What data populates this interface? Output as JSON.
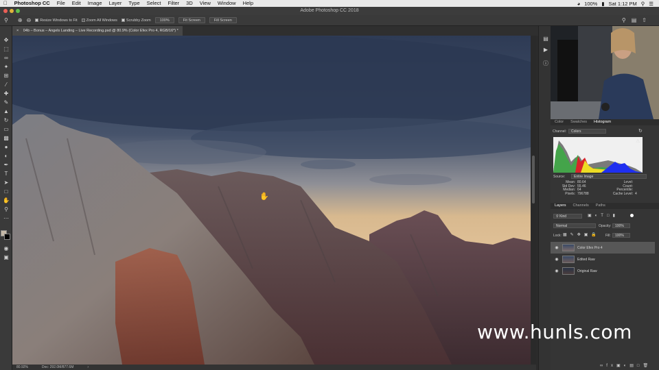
{
  "menubar": {
    "app": "Photoshop CC",
    "items": [
      "File",
      "Edit",
      "Image",
      "Layer",
      "Type",
      "Select",
      "Filter",
      "3D",
      "View",
      "Window",
      "Help"
    ],
    "battery": "100%",
    "clock": "Sat 1:12 PM"
  },
  "window": {
    "title": "Adobe Photoshop CC 2018"
  },
  "options": {
    "resize_windows": "Resize Windows to Fit",
    "zoom_all": "Zoom All Windows",
    "scrubby": "Scrubby Zoom",
    "zoom_value": "100%",
    "fit_screen": "Fit Screen",
    "fill_screen": "Fill Screen"
  },
  "document": {
    "tab_title": "04b – Bonus – Angels Landing – Live Recording.psd @ 80.9% (Color Efex Pro 4, RGB/16*) *"
  },
  "status": {
    "zoom": "80.92%",
    "doc": "Doc: 292.0M/877.6M"
  },
  "histogram_panel": {
    "tabs": [
      "Color",
      "Swatches",
      "Histogram"
    ],
    "channel_label": "Channel:",
    "channel_value": "Colors",
    "source_label": "Source:",
    "source_value": "Entire Image",
    "stats": [
      {
        "k": "Mean:",
        "v": "80.64"
      },
      {
        "k": "Std Dev:",
        "v": "55.46"
      },
      {
        "k": "Median:",
        "v": "64"
      },
      {
        "k": "Pixels:",
        "v": "796788"
      }
    ],
    "stats_right": [
      {
        "k": "Level:",
        "v": ""
      },
      {
        "k": "Count:",
        "v": ""
      },
      {
        "k": "Percentile:",
        "v": ""
      },
      {
        "k": "Cache Level:",
        "v": "4"
      }
    ]
  },
  "layers_panel": {
    "tabs": [
      "Layers",
      "Channels",
      "Paths"
    ],
    "kind": "Kind",
    "blend_mode": "Normal",
    "opacity_label": "Opacity:",
    "opacity": "100%",
    "lock_label": "Lock:",
    "fill_label": "Fill:",
    "fill": "100%",
    "layers": [
      {
        "name": "Color Efex Pro 4",
        "active": true
      },
      {
        "name": "Edited Raw",
        "active": false
      },
      {
        "name": "Original Raw",
        "active": false
      }
    ]
  },
  "watermark": "www.hunls.com"
}
